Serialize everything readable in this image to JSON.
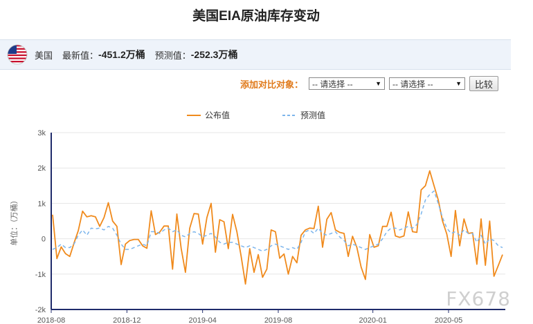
{
  "page": {
    "title": "美国EIA原油库存变动",
    "country": "美国",
    "latest_label": "最新值：",
    "latest_value": "-451.2万桶",
    "forecast_label": "预测值：",
    "forecast_value": "-252.3万桶",
    "compare_label": "添加对比对象：",
    "select_placeholder_1": "-- 请选择 --",
    "select_placeholder_2": "-- 请选择 --",
    "compare_button": "比较",
    "watermark": "FX678"
  },
  "colors": {
    "actual": "#f08a1c",
    "forecast": "#7cb5ec",
    "axis": "#1f2b6b",
    "grid": "#e6e6e6",
    "compare_label": "#e07a1b"
  },
  "chart_data": {
    "type": "line",
    "ylabel": "单位：（万桶）",
    "ylim": [
      -2000,
      3000
    ],
    "yticks": [
      -2000,
      -1000,
      0,
      1000,
      2000,
      3000
    ],
    "ytick_labels": [
      "-2k",
      "-1k",
      "0",
      "1k",
      "2k",
      "3k"
    ],
    "x_start": "2018-08",
    "x_end": "2020-08",
    "xtick_labels": [
      "2018-08",
      "2018-12",
      "2019-04",
      "2019-08",
      "2020-01",
      "2020-05"
    ],
    "grid": true,
    "legend_position": "top-center",
    "series": [
      {
        "name": "公布值",
        "style": "solid",
        "values": [
          680,
          -560,
          -230,
          -420,
          -500,
          -120,
          230,
          780,
          620,
          650,
          620,
          350,
          600,
          1020,
          500,
          350,
          -730,
          -150,
          -50,
          -20,
          -20,
          -200,
          -270,
          790,
          120,
          190,
          360,
          360,
          -860,
          700,
          -270,
          -950,
          300,
          710,
          700,
          -150,
          600,
          1000,
          -380,
          540,
          480,
          -280,
          690,
          200,
          -500,
          -1280,
          -280,
          -950,
          -450,
          -1090,
          -860,
          250,
          200,
          -550,
          -430,
          -1000,
          -500,
          -680,
          100,
          250,
          300,
          290,
          920,
          -240,
          550,
          740,
          250,
          180,
          150,
          -500,
          70,
          -240,
          -800,
          -1150,
          120,
          -240,
          -200,
          350,
          350,
          750,
          80,
          40,
          80,
          760,
          200,
          180,
          1380,
          1500,
          1920,
          1500,
          1100,
          500,
          130,
          -500,
          800,
          -200,
          560,
          150,
          170,
          -720,
          560,
          -750,
          500,
          -1060,
          -760,
          -450
        ]
      },
      {
        "name": "预测值",
        "style": "dashed",
        "values": [
          -300,
          -250,
          -150,
          -250,
          -250,
          -150,
          100,
          250,
          100,
          300,
          280,
          300,
          250,
          350,
          300,
          100,
          -150,
          -300,
          -300,
          -250,
          -200,
          -150,
          -200,
          200,
          200,
          150,
          250,
          300,
          200,
          250,
          100,
          50,
          150,
          200,
          150,
          50,
          100,
          150,
          50,
          -100,
          -150,
          -100,
          -100,
          -150,
          -200,
          -250,
          -200,
          -250,
          -300,
          -350,
          -300,
          -200,
          -150,
          -200,
          -250,
          -300,
          -250,
          -300,
          -100,
          200,
          250,
          150,
          300,
          150,
          100,
          150,
          200,
          50,
          -50,
          -200,
          -150,
          -200,
          -250,
          -300,
          -250,
          -200,
          -150,
          0,
          200,
          300,
          300,
          250,
          300,
          350,
          300,
          400,
          700,
          1100,
          1250,
          1350,
          1000,
          600,
          300,
          150,
          200,
          100,
          250,
          150,
          150,
          -100,
          100,
          -150,
          0,
          -50,
          -200,
          -250
        ]
      }
    ]
  }
}
